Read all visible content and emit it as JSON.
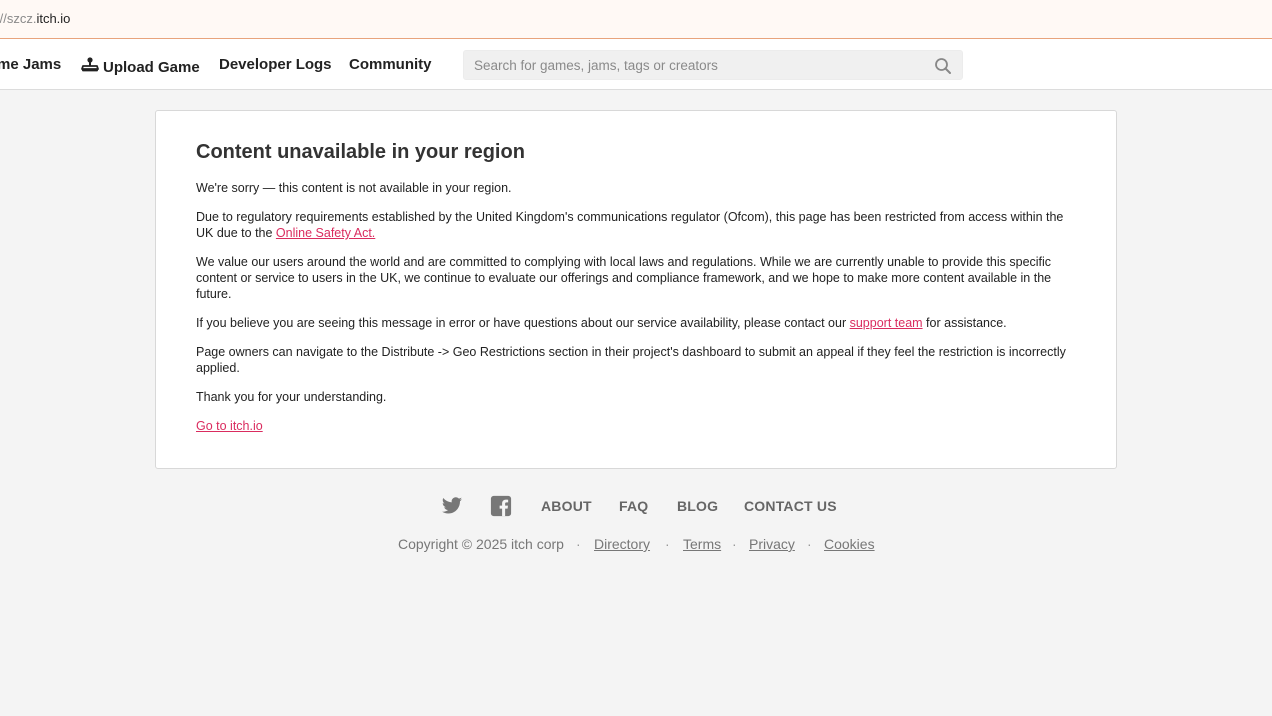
{
  "browser": {
    "url_prefix": "://szcz.",
    "url_host": "itch.io"
  },
  "nav": {
    "items": [
      {
        "label": "me Jams"
      },
      {
        "label": "Upload Game",
        "icon": "joystick-icon"
      },
      {
        "label": "Developer Logs"
      },
      {
        "label": "Community"
      }
    ],
    "search_placeholder": "Search for games, jams, tags or creators"
  },
  "content": {
    "title": "Content unavailable in your region",
    "p1": "We're sorry — this content is not available in your region.",
    "p2_text": "Due to regulatory requirements established by the United Kingdom's communications regulator (Ofcom), this page has been restricted from access within the UK due to the ",
    "p2_link": "Online Safety Act.",
    "p3": "We value our users around the world and are committed to complying with local laws and regulations. While we are currently unable to provide this specific content or service to users in the UK, we continue to evaluate our offerings and compliance framework, and we hope to make more content available in the future.",
    "p4_text": "If you believe you are seeing this message in error or have questions about our service availability, please contact our ",
    "p4_link": "support team",
    "p4_after": " for assistance.",
    "p5": "Page owners can navigate to the Distribute -> Geo Restrictions section in their project's dashboard to submit an appeal if they feel the restriction is incorrectly applied.",
    "p6": "Thank you for your understanding.",
    "home_link": "Go to itch.io"
  },
  "footer": {
    "icons": [
      "twitter-icon",
      "facebook-icon"
    ],
    "links": {
      "about": "ABOUT",
      "faq": "FAQ",
      "blog": "BLOG",
      "contact": "CONTACT US"
    },
    "copyright": "Copyright © 2025 itch corp",
    "separator": "·",
    "bottom_links": {
      "directory": "Directory",
      "terms": "Terms",
      "privacy": "Privacy",
      "cookies": "Cookies"
    }
  },
  "colors": {
    "link": "#da2c5f",
    "url_bar_border": "#e8a47c",
    "background": "#f4f4f4"
  }
}
